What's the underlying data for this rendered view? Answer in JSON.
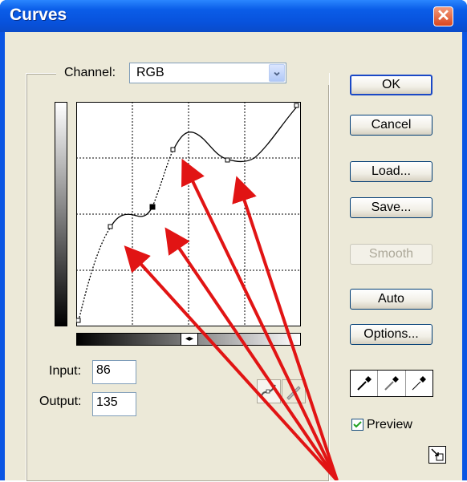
{
  "window": {
    "title": "Curves",
    "close_symbol": "✕"
  },
  "channel": {
    "label": "Channel:",
    "value": "RGB",
    "dropdown_symbol": "⌄"
  },
  "buttons": {
    "ok": "OK",
    "cancel": "Cancel",
    "load": "Load...",
    "save": "Save...",
    "smooth": "Smooth",
    "auto": "Auto",
    "options": "Options..."
  },
  "input": {
    "label": "Input:",
    "value": "86"
  },
  "output": {
    "label": "Output:",
    "value": "135"
  },
  "gradient_toggle_symbol": "◂▸",
  "preview": {
    "label": "Preview",
    "checked": true
  },
  "colors": {
    "titlebar": "#0a5de8",
    "dialog_bg": "#ece9d8",
    "annotation_arrow": "#e11414",
    "button_border": "#003c74"
  },
  "icons": [
    "curve-tool-icon",
    "pencil-icon",
    "black-eyedropper-icon",
    "gray-eyedropper-icon",
    "white-eyedropper-icon",
    "resize-icon"
  ]
}
